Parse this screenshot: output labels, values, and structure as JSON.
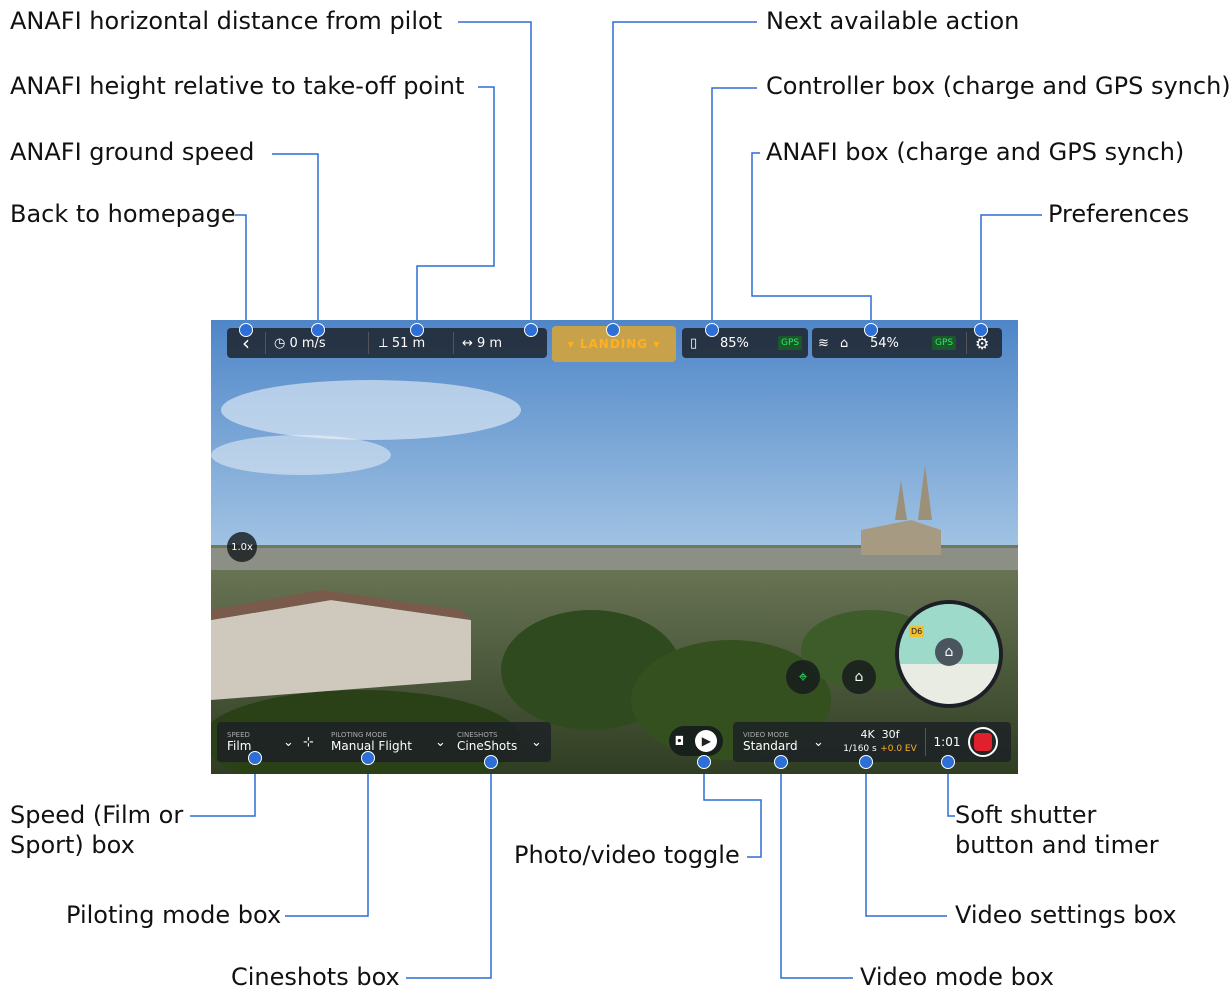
{
  "callouts": {
    "horizontal_distance": "ANAFI horizontal distance from pilot",
    "height": "ANAFI height relative to take-off point",
    "ground_speed": "ANAFI ground speed",
    "back": "Back to homepage",
    "next_action": "Next available action",
    "controller_box": "Controller box (charge and GPS synch)",
    "anafi_box": "ANAFI box (charge and GPS synch)",
    "preferences": "Preferences",
    "speed_box_line1": "Speed (Film or",
    "speed_box_line2": "Sport) box",
    "piloting_box": "Piloting mode box",
    "cineshots_box": "Cineshots box",
    "photo_video": "Photo/video toggle",
    "video_mode_box": "Video mode box",
    "video_settings_box": "Video settings box",
    "shutter_line1": "Soft shutter",
    "shutter_line2": "button and timer"
  },
  "hud": {
    "back_symbol": "‹",
    "speed": "0 m/s",
    "height": "51 m",
    "distance": "9 m",
    "action": "LANDING",
    "controller_charge": "85%",
    "controller_gps": "GPS",
    "drone_charge": "54%",
    "drone_gps": "GPS",
    "zoom": "1.0x",
    "map_label": "D6",
    "speed_mode_label": "SPEED",
    "speed_mode": "Film",
    "piloting_label": "PILOTING MODE",
    "piloting_mode": "Manual Flight",
    "cineshots_label": "CINESHOTS",
    "cineshots": "CineShots",
    "video_mode_label": "VIDEO MODE",
    "video_mode": "Standard",
    "resolution": "4K",
    "framerate": "30f",
    "shutter": "1/160 s",
    "ev": "+0.0 EV",
    "timer": "1:01"
  },
  "colors": {
    "connector": "#2d6fd6",
    "action_box": "#c8a24a",
    "action_text": "#ffb020",
    "gps": "#2ee86a",
    "record": "#e0202a"
  },
  "icons": [
    "back-icon",
    "speedometer-icon",
    "height-icon",
    "distance-icon",
    "action-chevron-icon",
    "controller-icon",
    "wifi-icon",
    "drone-icon",
    "gear-icon",
    "chevron-down-icon",
    "piloting-icon",
    "photo-icon",
    "video-icon",
    "target-icon",
    "home-icon",
    "record-icon"
  ]
}
